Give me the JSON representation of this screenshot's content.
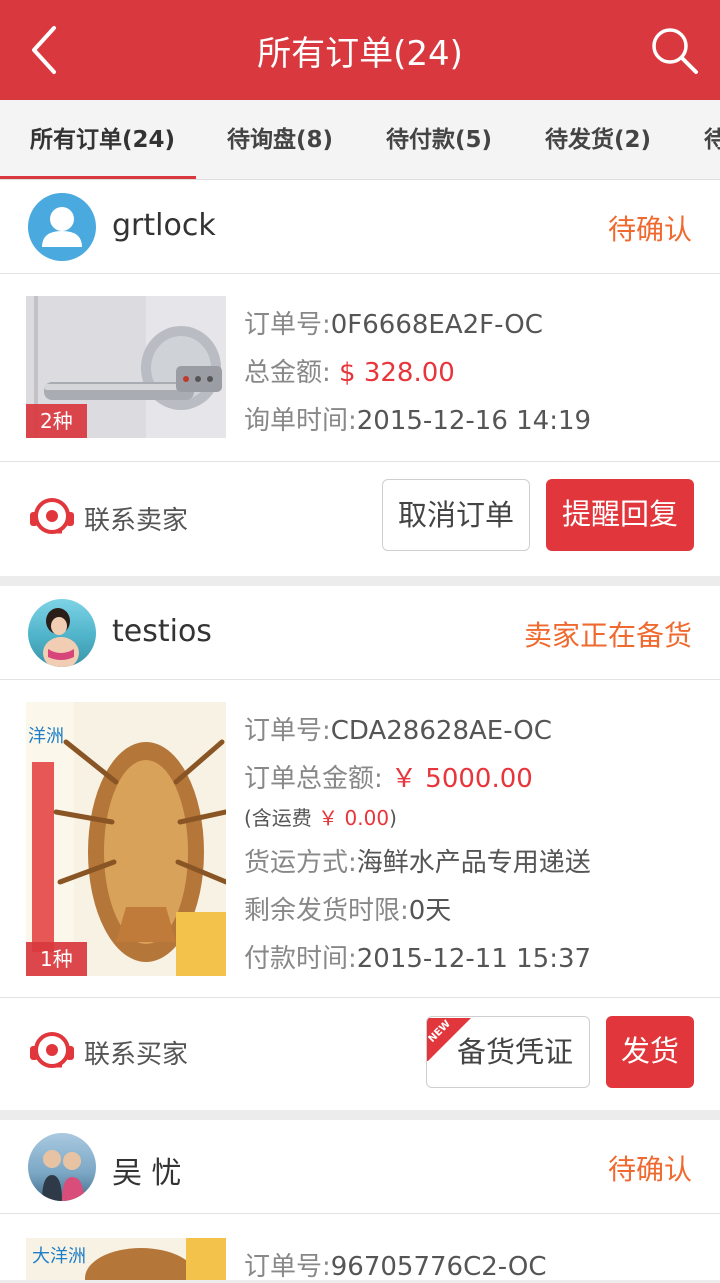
{
  "header": {
    "title": "所有订单(24)"
  },
  "tabs": [
    {
      "label": "所有订单(24)"
    },
    {
      "label": "待询盘(8)"
    },
    {
      "label": "待付款(5)"
    },
    {
      "label": "待发货(2)"
    },
    {
      "label": "待"
    }
  ],
  "orders": [
    {
      "user": "grtlock",
      "status": "待确认",
      "badge": "2种",
      "order_no_label": "订单号:",
      "order_no": "0F6668EA2F-OC",
      "total_label": "总金额:",
      "total": "$ 328.00",
      "time_label": "询单时间:",
      "time": "2015-12-16 14:19",
      "contact_label": "联系卖家",
      "btn1": "取消订单",
      "btn2": "提醒回复"
    },
    {
      "user": "testios",
      "status": "卖家正在备货",
      "badge": "1种",
      "order_no_label": "订单号:",
      "order_no": "CDA28628AE-OC",
      "total_label": "订单总金额:",
      "total": "￥ 5000.00",
      "shipping_prefix": "(含运费",
      "shipping_fee": "￥ 0.00",
      "shipping_suffix": ")",
      "ship_method_label": "货运方式:",
      "ship_method": "海鲜水产品专用递送",
      "remain_label": "剩余发货时限:",
      "remain": "0天",
      "time_label": "付款时间:",
      "time": "2015-12-11 15:37",
      "contact_label": "联系买家",
      "new_tag": "NEW",
      "btn1": "备货凭证",
      "btn2": "发货"
    },
    {
      "user": "吴 忧",
      "status": "待确认",
      "order_no_label": "订单号:",
      "order_no": "96705776C2-OC"
    }
  ],
  "colors": {
    "brand": "#d9393e",
    "status": "#f06a30",
    "price": "#e8353c"
  }
}
